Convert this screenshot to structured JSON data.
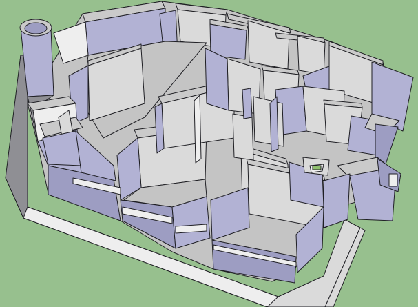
{
  "viewport": {
    "background_color": "#97c08e",
    "model_colors": {
      "floor": "#c4c4c4",
      "wall_top": "#cacaca",
      "wall_face_blue": "#b2b2d4",
      "wall_face_dark": "#9d9dc2",
      "wall_face_gray": "#dadada",
      "edge": "#1f1f24"
    }
  }
}
